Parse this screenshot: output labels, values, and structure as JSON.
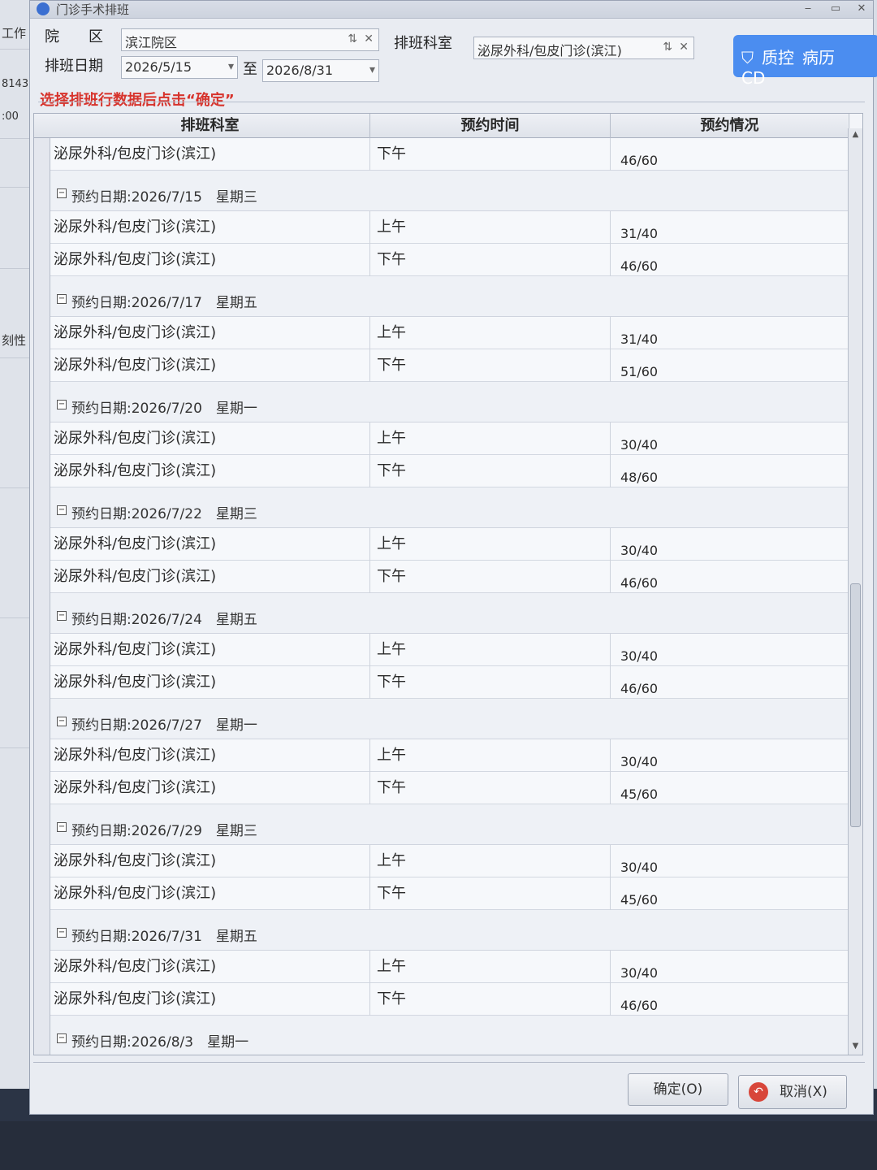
{
  "window": {
    "title": "门诊手术排班"
  },
  "background": {
    "left_labels": [
      "工作",
      "8143",
      ":00",
      "刻性"
    ]
  },
  "filter": {
    "campus_label": "院　　区",
    "campus_value": "滨江院区",
    "dept_label": "排班科室",
    "dept_value": "泌尿外科/包皮门诊(滨江)",
    "date_label": "排班日期",
    "date_from": "2026/5/15",
    "date_to_label": "至",
    "date_to": "2026/8/31"
  },
  "qc_button": {
    "label1": "质控",
    "label2": "病历",
    "label3": "CD"
  },
  "hint": "选择排班行数据后点击“确定”",
  "grid": {
    "headers": [
      "排班科室",
      "预约时间",
      "预约情况"
    ],
    "first_row": {
      "dept": "泌尿外科/包皮门诊(滨江)",
      "time": "下午",
      "status": "46/60"
    },
    "groups": [
      {
        "header": "预约日期:2026/7/15　星期三",
        "rows": [
          {
            "dept": "泌尿外科/包皮门诊(滨江)",
            "time": "上午",
            "status": "31/40"
          },
          {
            "dept": "泌尿外科/包皮门诊(滨江)",
            "time": "下午",
            "status": "46/60"
          }
        ]
      },
      {
        "header": "预约日期:2026/7/17　星期五",
        "rows": [
          {
            "dept": "泌尿外科/包皮门诊(滨江)",
            "time": "上午",
            "status": "31/40"
          },
          {
            "dept": "泌尿外科/包皮门诊(滨江)",
            "time": "下午",
            "status": "51/60"
          }
        ]
      },
      {
        "header": "预约日期:2026/7/20　星期一",
        "rows": [
          {
            "dept": "泌尿外科/包皮门诊(滨江)",
            "time": "上午",
            "status": "30/40"
          },
          {
            "dept": "泌尿外科/包皮门诊(滨江)",
            "time": "下午",
            "status": "48/60"
          }
        ]
      },
      {
        "header": "预约日期:2026/7/22　星期三",
        "rows": [
          {
            "dept": "泌尿外科/包皮门诊(滨江)",
            "time": "上午",
            "status": "30/40"
          },
          {
            "dept": "泌尿外科/包皮门诊(滨江)",
            "time": "下午",
            "status": "46/60"
          }
        ]
      },
      {
        "header": "预约日期:2026/7/24　星期五",
        "rows": [
          {
            "dept": "泌尿外科/包皮门诊(滨江)",
            "time": "上午",
            "status": "30/40"
          },
          {
            "dept": "泌尿外科/包皮门诊(滨江)",
            "time": "下午",
            "status": "46/60"
          }
        ]
      },
      {
        "header": "预约日期:2026/7/27　星期一",
        "rows": [
          {
            "dept": "泌尿外科/包皮门诊(滨江)",
            "time": "上午",
            "status": "30/40"
          },
          {
            "dept": "泌尿外科/包皮门诊(滨江)",
            "time": "下午",
            "status": "45/60"
          }
        ]
      },
      {
        "header": "预约日期:2026/7/29　星期三",
        "rows": [
          {
            "dept": "泌尿外科/包皮门诊(滨江)",
            "time": "上午",
            "status": "30/40"
          },
          {
            "dept": "泌尿外科/包皮门诊(滨江)",
            "time": "下午",
            "status": "45/60"
          }
        ]
      },
      {
        "header": "预约日期:2026/7/31　星期五",
        "rows": [
          {
            "dept": "泌尿外科/包皮门诊(滨江)",
            "time": "上午",
            "status": "30/40"
          },
          {
            "dept": "泌尿外科/包皮门诊(滨江)",
            "time": "下午",
            "status": "46/60"
          }
        ]
      },
      {
        "header": "预约日期:2026/8/3　星期一",
        "rows": []
      }
    ]
  },
  "buttons": {
    "ok": "确定(O)",
    "cancel": "取消(X)"
  }
}
